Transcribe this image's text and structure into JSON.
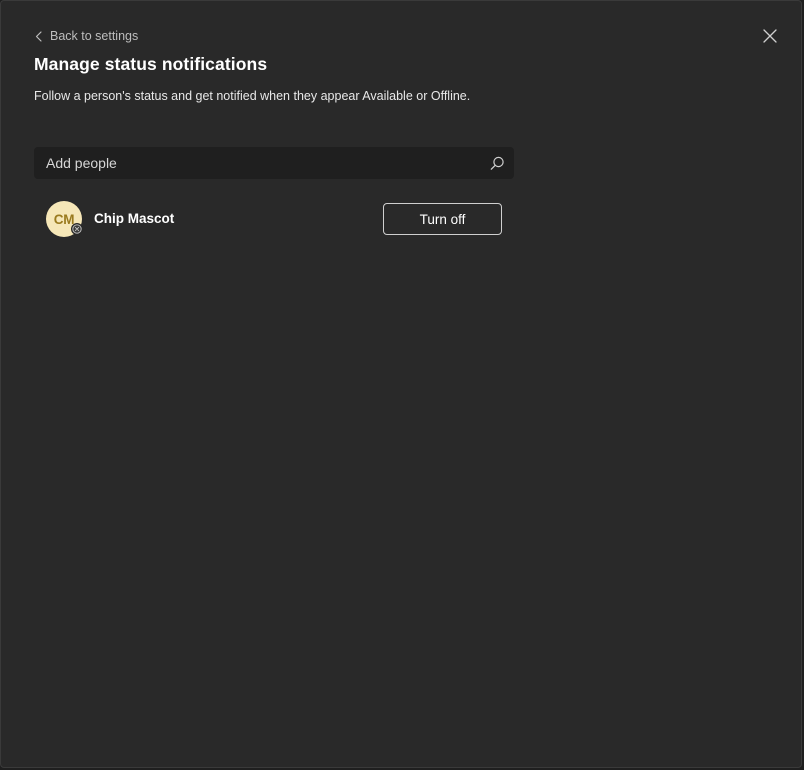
{
  "nav": {
    "back_label": "Back to settings",
    "back_icon": "chevron-left-icon",
    "close_icon": "close-icon"
  },
  "header": {
    "title": "Manage status notifications",
    "subtitle": "Follow a person's status and get notified when they appear Available or Offline."
  },
  "search": {
    "placeholder": "Add people",
    "value": "",
    "icon": "search-icon"
  },
  "people": [
    {
      "initials": "CM",
      "name": "Chip Mascot",
      "presence": "offline",
      "action_label": "Turn off"
    }
  ],
  "colors": {
    "background": "#292929",
    "avatar_bg": "#f6e7b8",
    "avatar_text": "#9a7a1e",
    "text_primary": "#ffffff",
    "text_secondary": "#bdbdbd"
  }
}
